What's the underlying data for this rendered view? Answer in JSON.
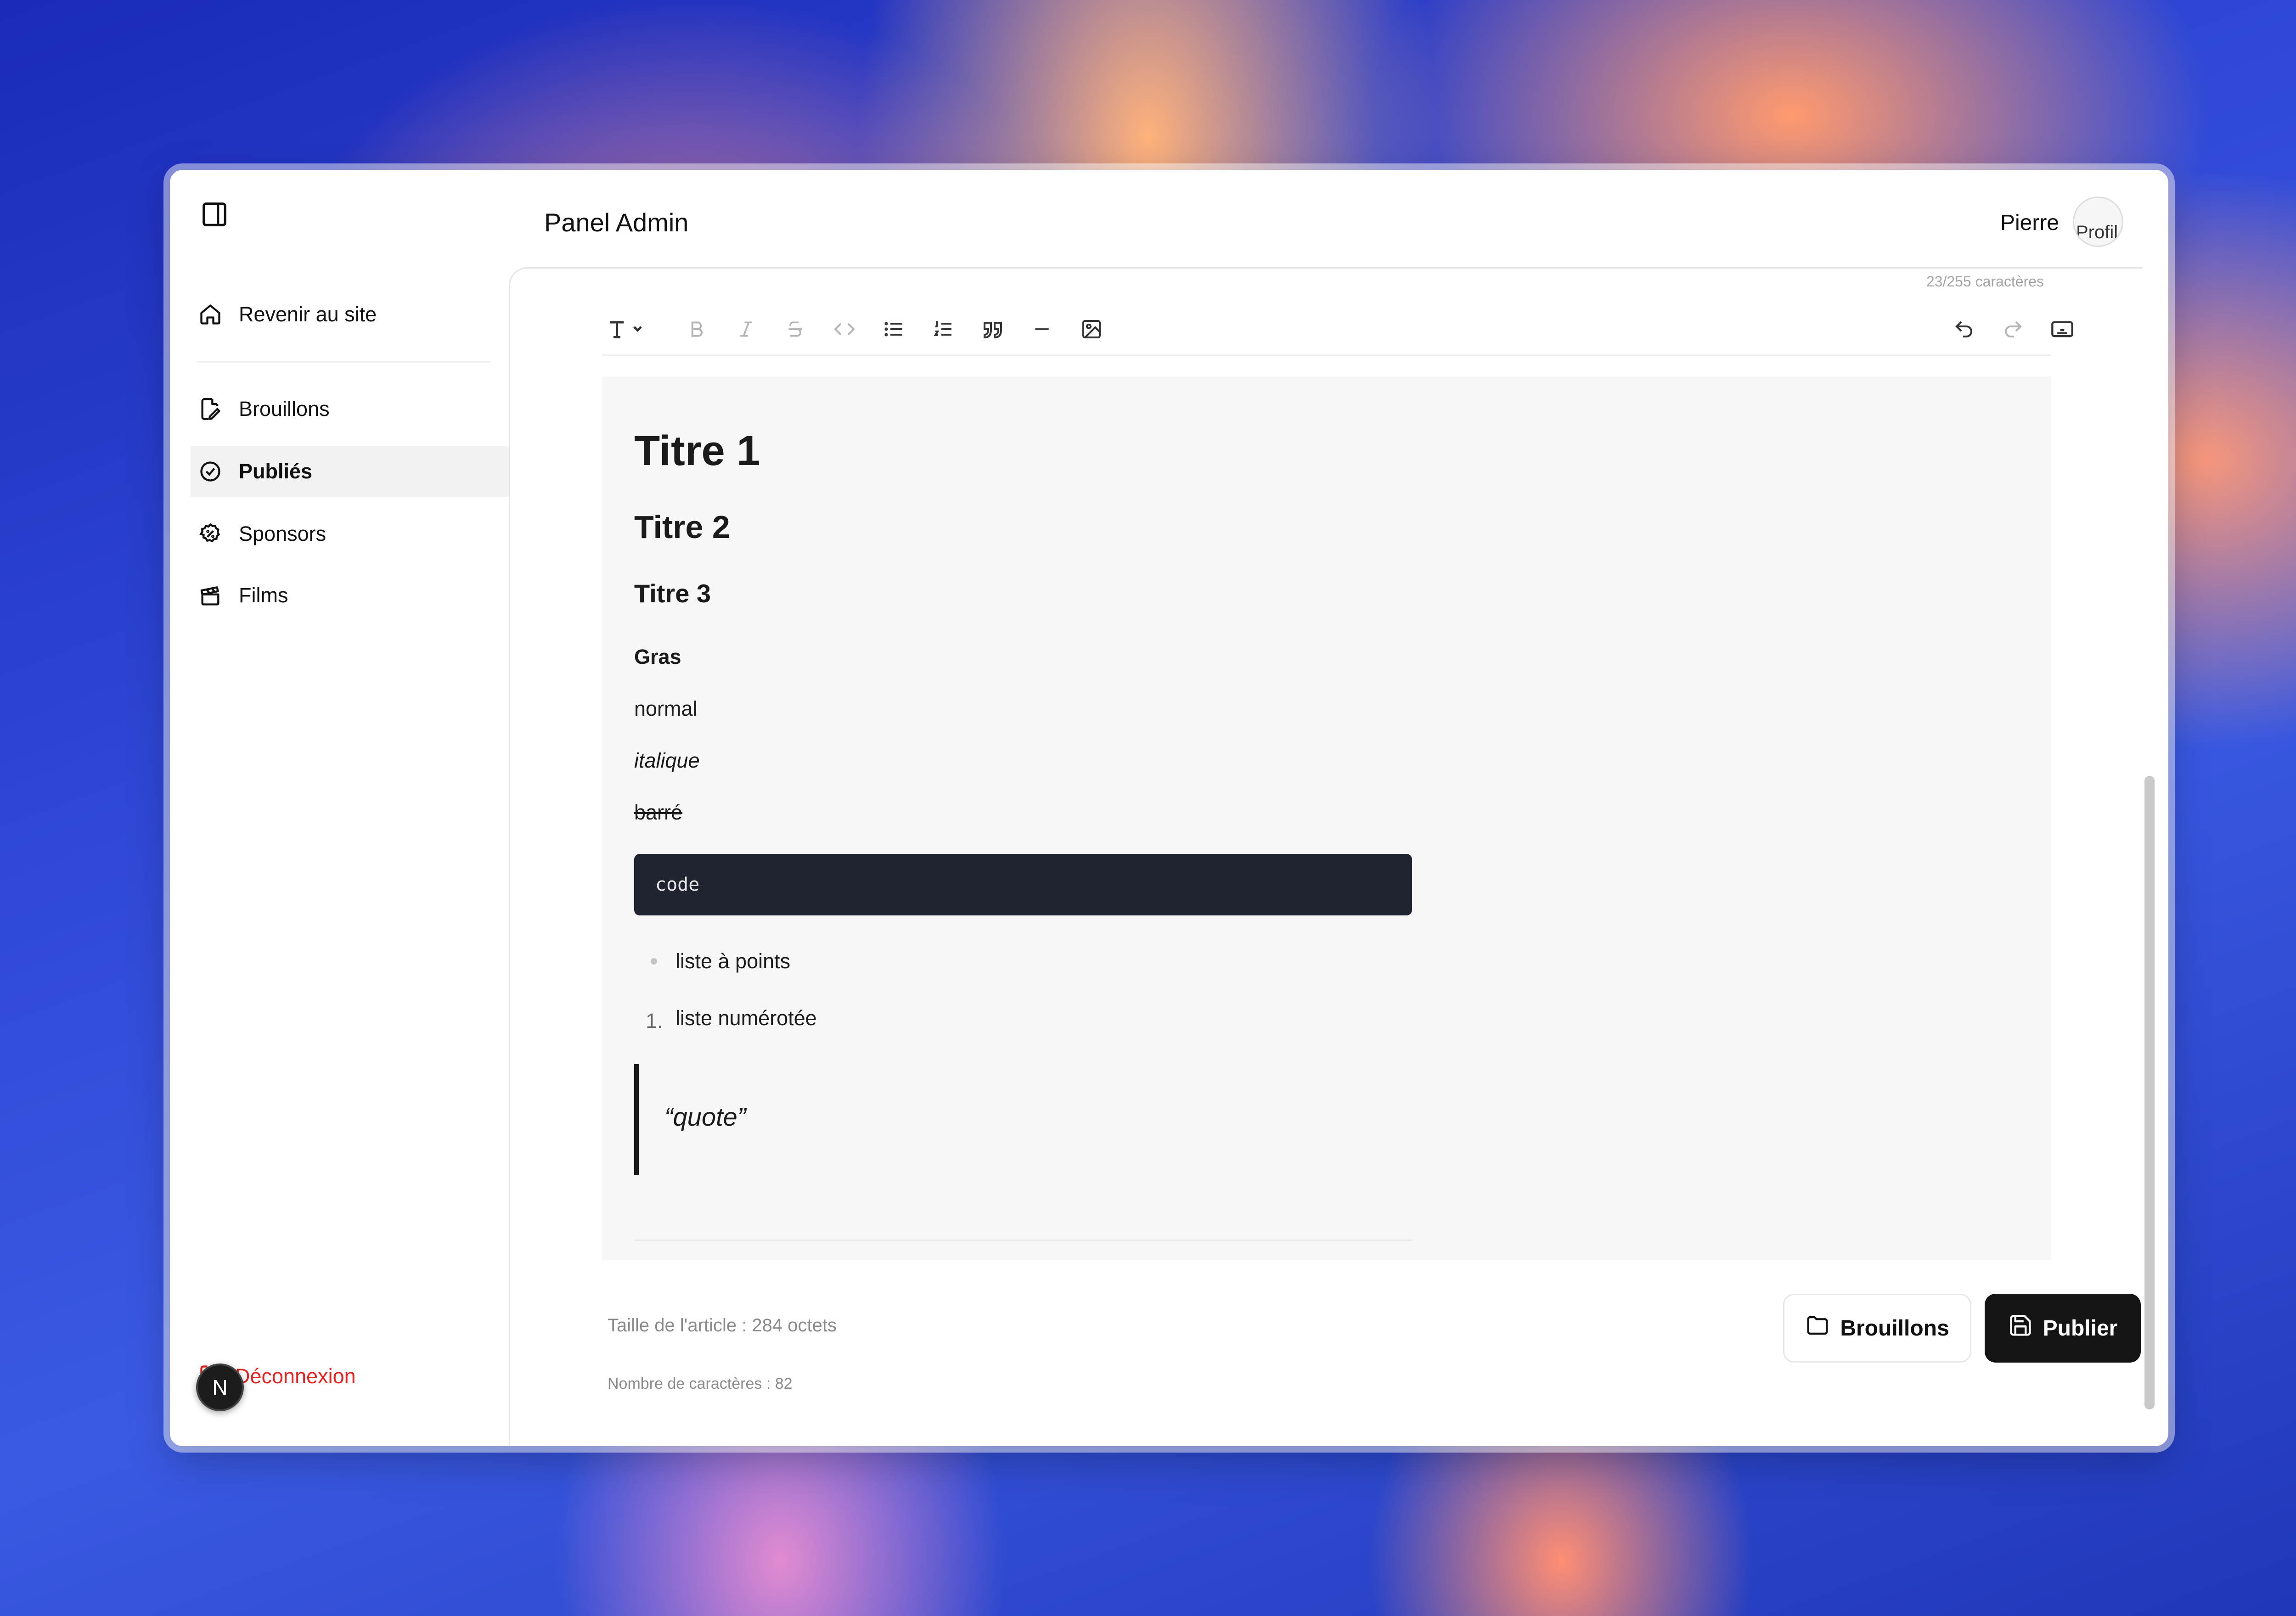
{
  "header": {
    "title": "Panel Admin",
    "user_name": "Pierre",
    "avatar_alt": "Profil"
  },
  "sidebar": {
    "items": [
      {
        "label": "Revenir au site",
        "icon": "home-icon"
      },
      {
        "label": "Brouillons",
        "icon": "file-edit-icon"
      },
      {
        "label": "Publiés",
        "icon": "check-circle-icon",
        "active": true
      },
      {
        "label": "Sponsors",
        "icon": "badge-percent-icon"
      },
      {
        "label": "Films",
        "icon": "clapperboard-icon"
      }
    ],
    "logout_label": "Déconnexion",
    "dev_badge": "N"
  },
  "editor": {
    "char_limit": "23/255 caractères",
    "content": {
      "h1": "Titre 1",
      "h2": "Titre 2",
      "h3": "Titre 3",
      "bold": "Gras",
      "normal": "normal",
      "italic": "italique",
      "strike": "barré",
      "code": "code",
      "bullet_item": "liste à points",
      "ordered_number": "1.",
      "ordered_item": "liste numérotée",
      "quote": "“quote”"
    }
  },
  "footer": {
    "article_size": "Taille de l'article : 284 octets",
    "char_count": "Nombre de caractères : 82",
    "drafts_button": "Brouillons",
    "publish_button": "Publier"
  },
  "colors": {
    "danger": "#e02424",
    "primary_button": "#141414",
    "code_bg": "#1f2430"
  }
}
